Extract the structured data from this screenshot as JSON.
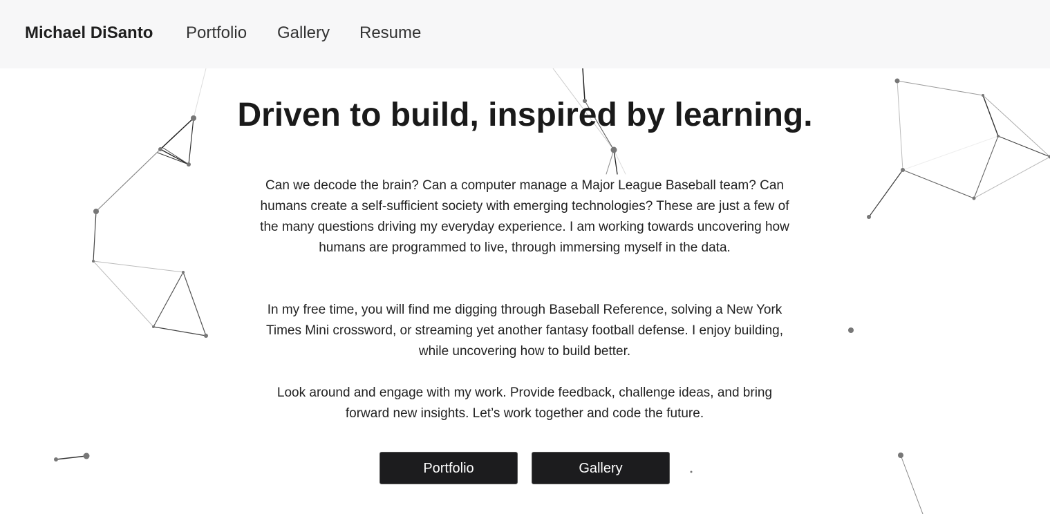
{
  "navbar": {
    "brand": "Michael DiSanto",
    "links": [
      "Portfolio",
      "Gallery",
      "Resume"
    ]
  },
  "hero": {
    "headline": "Driven to build, inspired by learning.",
    "paragraphs": [
      "Can we decode the brain? Can a computer manage a Major League Baseball team? Can humans create a self-sufficient society with emerging technologies? These are just a few of the many questions driving my everyday experience. I am working towards uncovering how humans are programmed to live, through immersing myself in the data.",
      "In my free time, you will find me digging through Baseball Reference, solving a New York Times Mini crossword, or streaming yet another fantasy football defense. I enjoy building, while uncovering how to build better.",
      "Look around and engage with my work. Provide feedback, challenge ideas, and bring forward new insights. Let’s work together and code the future."
    ],
    "buttons": [
      "Portfolio",
      "Gallery"
    ]
  },
  "colors": {
    "navbar_bg": "#f7f7f8",
    "button_bg": "#1c1c1e",
    "text": "#222222",
    "network_line": "#555555"
  }
}
